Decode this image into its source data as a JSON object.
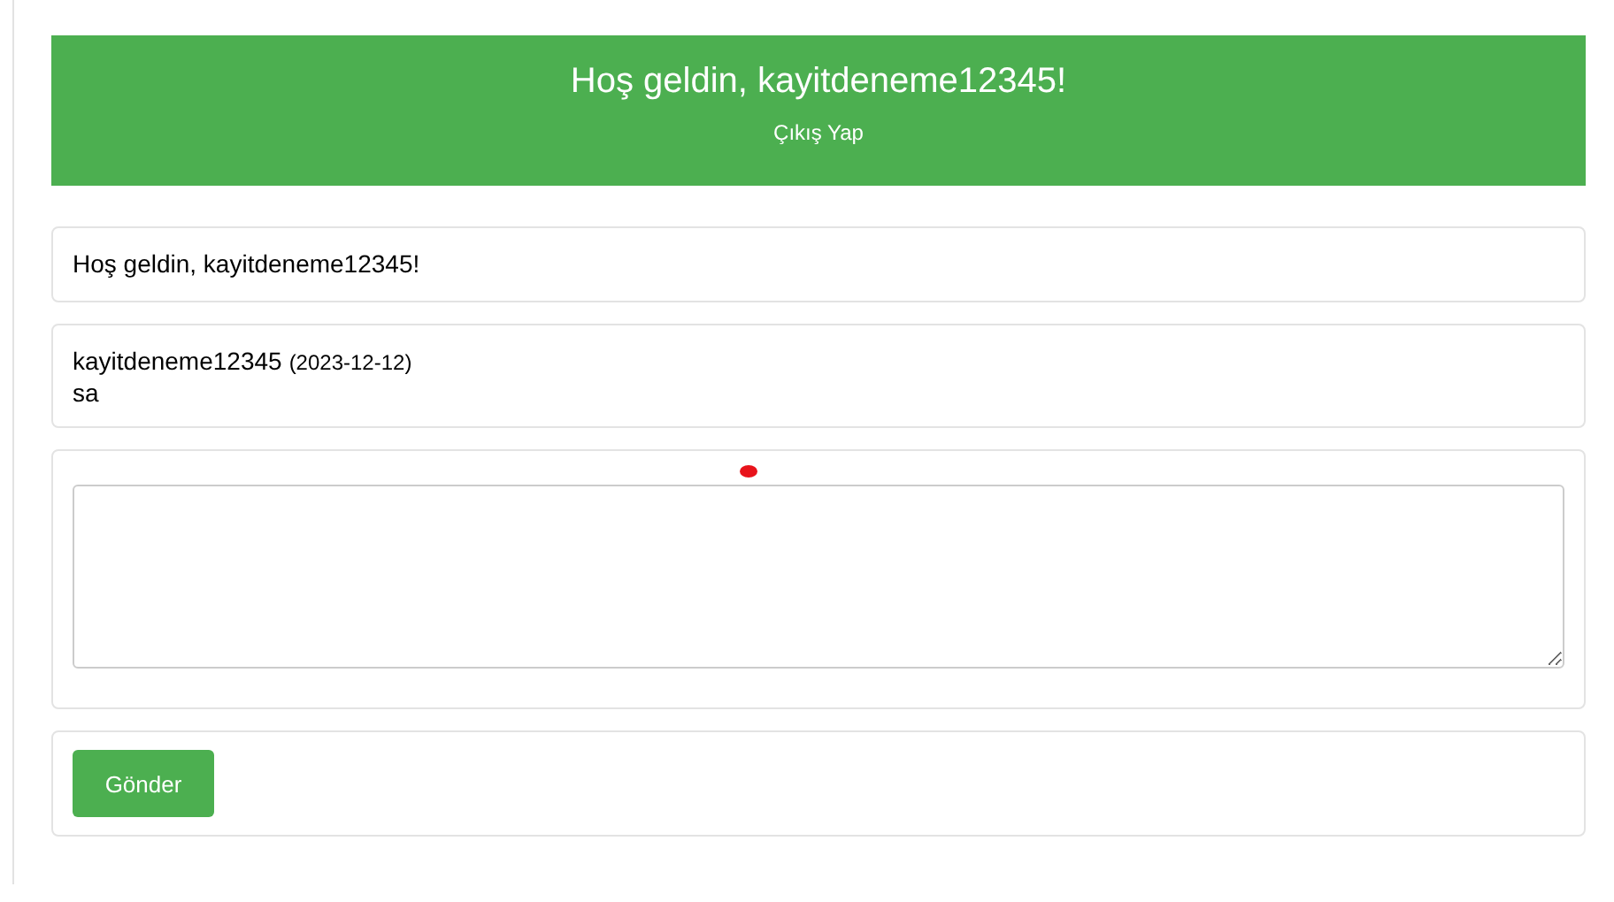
{
  "header": {
    "title": "Hoş geldin, kayitdeneme12345!",
    "logout_link": "Çıkış Yap"
  },
  "welcome_card": {
    "text": "Hoş geldin, kayitdeneme12345!"
  },
  "messages": [
    {
      "user": "kayitdeneme12345",
      "date": "(2023-12-12)",
      "text": "sa"
    }
  ],
  "send_button": "Gönder"
}
